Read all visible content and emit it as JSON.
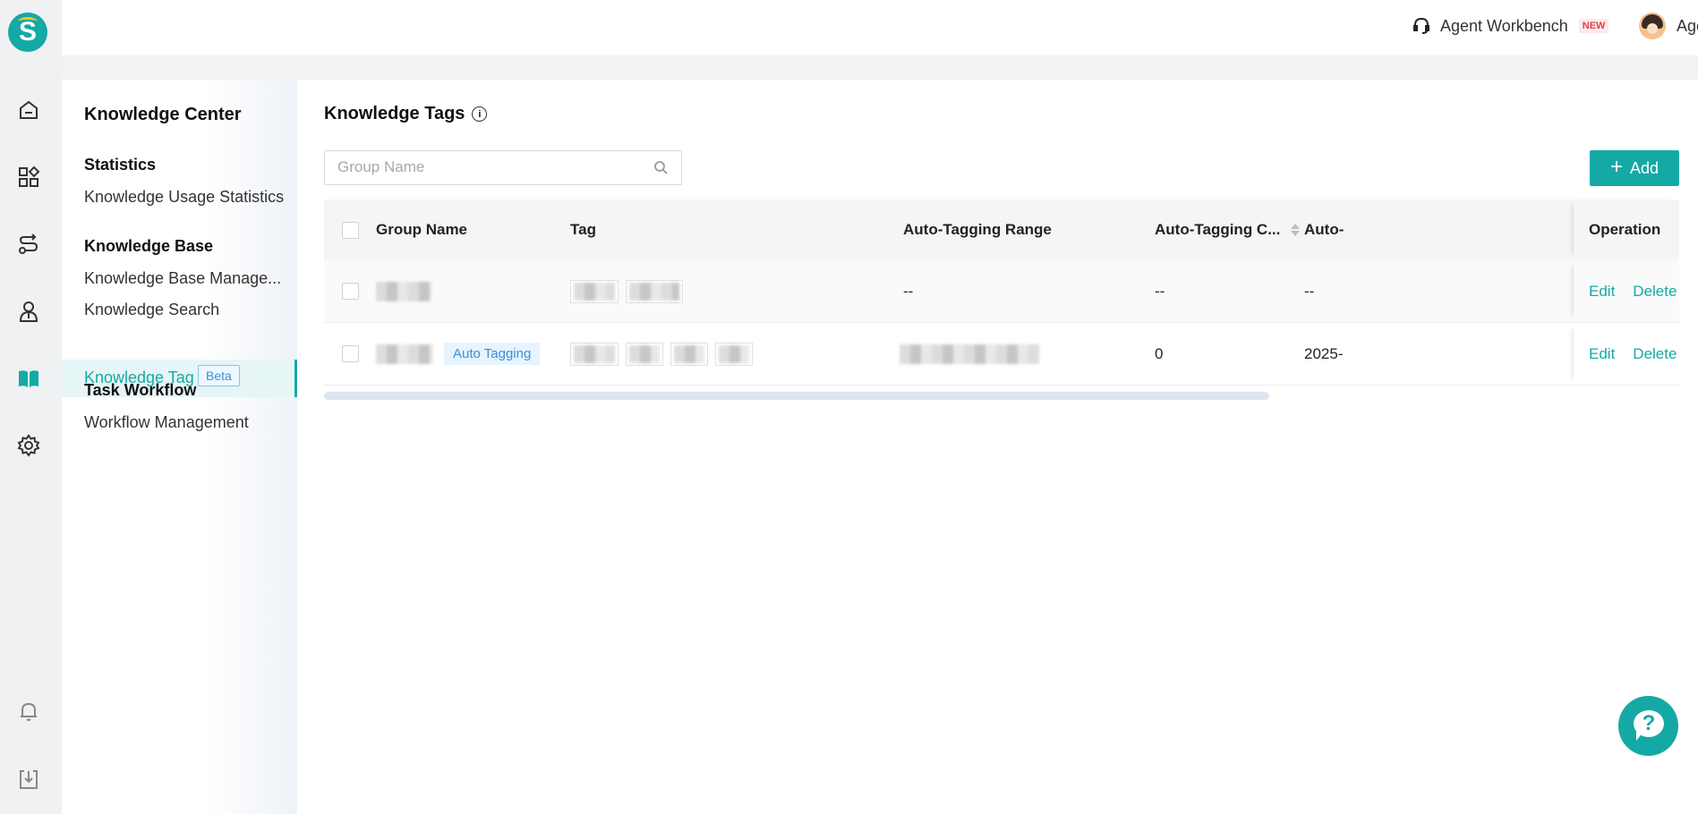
{
  "topbar": {
    "workbench_label": "Agent Workbench",
    "new_badge": "NEW",
    "user_name": "Agent"
  },
  "rail": {
    "logo_letter": "S",
    "icons": [
      "home-icon",
      "apps-icon",
      "routing-icon",
      "agent-icon",
      "knowledge-book-icon",
      "settings-icon",
      "bell-icon",
      "download-icon"
    ]
  },
  "subnav": {
    "title": "Knowledge Center",
    "sections": [
      {
        "heading": "Statistics",
        "items": [
          "Knowledge Usage Statistics"
        ]
      },
      {
        "heading": "Knowledge Base",
        "items": [
          "Knowledge Base Manage...",
          "Knowledge Search",
          "Knowledge Tag"
        ]
      },
      {
        "heading": "Task Workflow",
        "items": [
          "Workflow Management"
        ]
      }
    ],
    "active_item": "Knowledge Tag",
    "beta_badge": "Beta"
  },
  "main": {
    "title": "Knowledge Tags",
    "search_placeholder": "Group Name",
    "add_label": "Add",
    "columns": [
      "Group Name",
      "Tag",
      "Auto-Tagging Range",
      "Auto-Tagging C...",
      "Auto-",
      "Operation"
    ],
    "rows": [
      {
        "range": "--",
        "count": "--",
        "time": "--",
        "auto_tag": ""
      },
      {
        "range": "",
        "count": "0",
        "time": "2025-",
        "auto_tag": "Auto Tagging"
      }
    ],
    "edit_label": "Edit",
    "delete_label": "Delete"
  },
  "help_glyph": "?"
}
